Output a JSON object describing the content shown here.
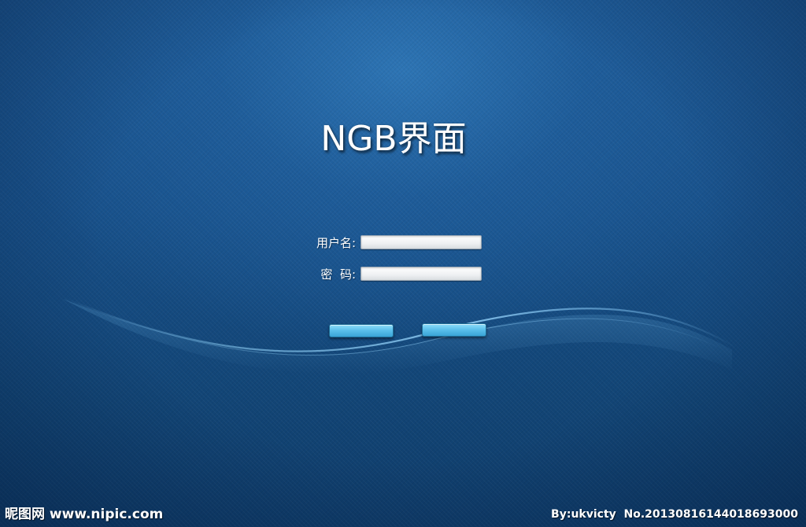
{
  "app": {
    "title": "NGB界面"
  },
  "login_form": {
    "username_label": "用户名:",
    "username_value": "",
    "password_label": "密  码:",
    "password_value": ""
  },
  "buttons": {
    "left_label": "",
    "right_label": ""
  },
  "watermark": {
    "site_text": "昵图网 www.nipic.com",
    "credit_text": "By:ukvicty  No.20130816144018693000"
  },
  "colors": {
    "background": "#174f88",
    "button_accent": "#5cc1ec",
    "text": "#ffffff"
  }
}
